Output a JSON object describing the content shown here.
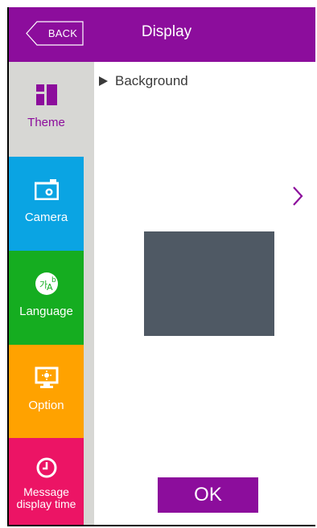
{
  "header": {
    "back_label": "BACK",
    "title": "Display"
  },
  "sidebar": {
    "items": [
      {
        "label": "Theme",
        "icon": "theme-icon",
        "color": "#d7d7d4",
        "selected": true
      },
      {
        "label": "Camera",
        "icon": "camera-icon",
        "color": "#0aa4e3",
        "selected": false
      },
      {
        "label": "Language",
        "icon": "language-icon",
        "color": "#15ad20",
        "selected": false
      },
      {
        "label": "Option",
        "icon": "option-icon",
        "color": "#ffa200",
        "selected": false
      },
      {
        "label": "Message display time",
        "label_line1": "Message",
        "label_line2": "display time",
        "icon": "clock-icon",
        "color": "#ec1465",
        "selected": false
      }
    ]
  },
  "main": {
    "section_label": "Background",
    "preview_color": "#4f5964",
    "ok_label": "OK"
  },
  "colors": {
    "accent": "#8c0d9c"
  }
}
